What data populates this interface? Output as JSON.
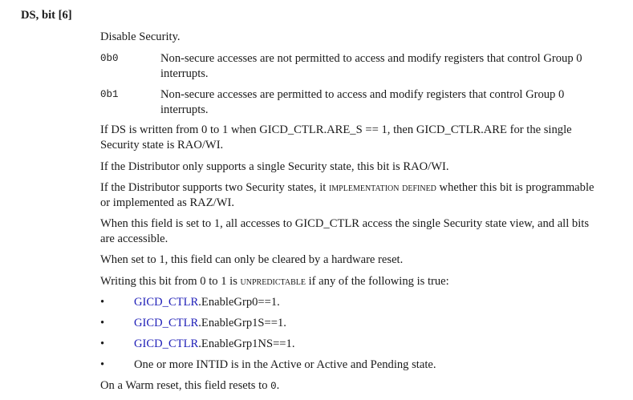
{
  "field_heading": "DS, bit [6]",
  "field_name": "Disable Security.",
  "values": [
    {
      "code": "0b0",
      "desc": "Non-secure accesses are not permitted to access and modify registers that control Group 0 interrupts."
    },
    {
      "code": "0b1",
      "desc": "Non-secure accesses are permitted to access and modify registers that control Group 0 interrupts."
    }
  ],
  "paragraphs": {
    "p1": "If DS is written from 0 to 1 when GICD_CTLR.ARE_S == 1, then GICD_CTLR.ARE for the single Security state is RAO/WI.",
    "p2": "If the Distributor only supports a single Security state, this bit is RAO/WI.",
    "p3_before": "If the Distributor supports two Security states, it ",
    "p3_term": "IMPLEMENTATION DEFINED",
    "p3_after": " whether this bit is programmable or implemented as RAZ/WI.",
    "p4": "When this field is set to 1, all accesses to GICD_CTLR access the single Security state view, and all bits are accessible.",
    "p5": "When set to 1, this field can only be cleared by a hardware reset.",
    "p6_before": "Writing this bit from 0 to 1 is ",
    "p6_term": "UNPREDICTABLE",
    "p6_after": " if any of the following is true:"
  },
  "bullets": [
    {
      "link": "GICD_CTLR",
      "text": ".EnableGrp0==1."
    },
    {
      "link": "GICD_CTLR",
      "text": ".EnableGrp1S==1."
    },
    {
      "link": "GICD_CTLR",
      "text": ".EnableGrp1NS==1."
    },
    {
      "link": "",
      "text": "One or more INTID is in the Active or Active and Pending state."
    }
  ],
  "bullet_char": "•",
  "reset": {
    "before": "On a Warm reset, this field resets to ",
    "value": "0",
    "after": "."
  },
  "colors": {
    "link": "#2020b8",
    "text": "#1a1a1a"
  }
}
